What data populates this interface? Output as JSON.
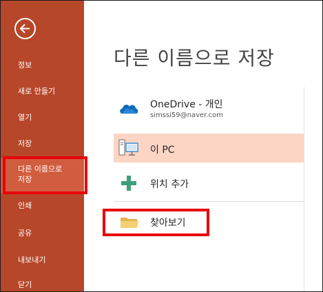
{
  "sidebar": {
    "items": [
      {
        "label": "정보"
      },
      {
        "label": "새로 만들기"
      },
      {
        "label": "열기"
      },
      {
        "label": "저장"
      },
      {
        "label_line1": "다른 이름으로",
        "label_line2": "저장"
      },
      {
        "label": "인쇄"
      },
      {
        "label": "공유"
      },
      {
        "label": "내보내기"
      },
      {
        "label": "닫기"
      }
    ]
  },
  "main": {
    "title": "다른 이름으로 저장",
    "locations": [
      {
        "label": "OneDrive - 개인",
        "sub": "simssi59@naver.com",
        "icon": "cloud-icon"
      },
      {
        "label": "이 PC",
        "icon": "computer-icon"
      },
      {
        "label": "위치 추가",
        "icon": "plus-icon"
      },
      {
        "label": "찾아보기",
        "icon": "folder-icon"
      }
    ]
  },
  "colors": {
    "sidebar_bg": "#b7472a",
    "sidebar_selected": "#d15d3f",
    "highlight_border": "#e8000b",
    "location_selected": "#fcd5c5"
  }
}
